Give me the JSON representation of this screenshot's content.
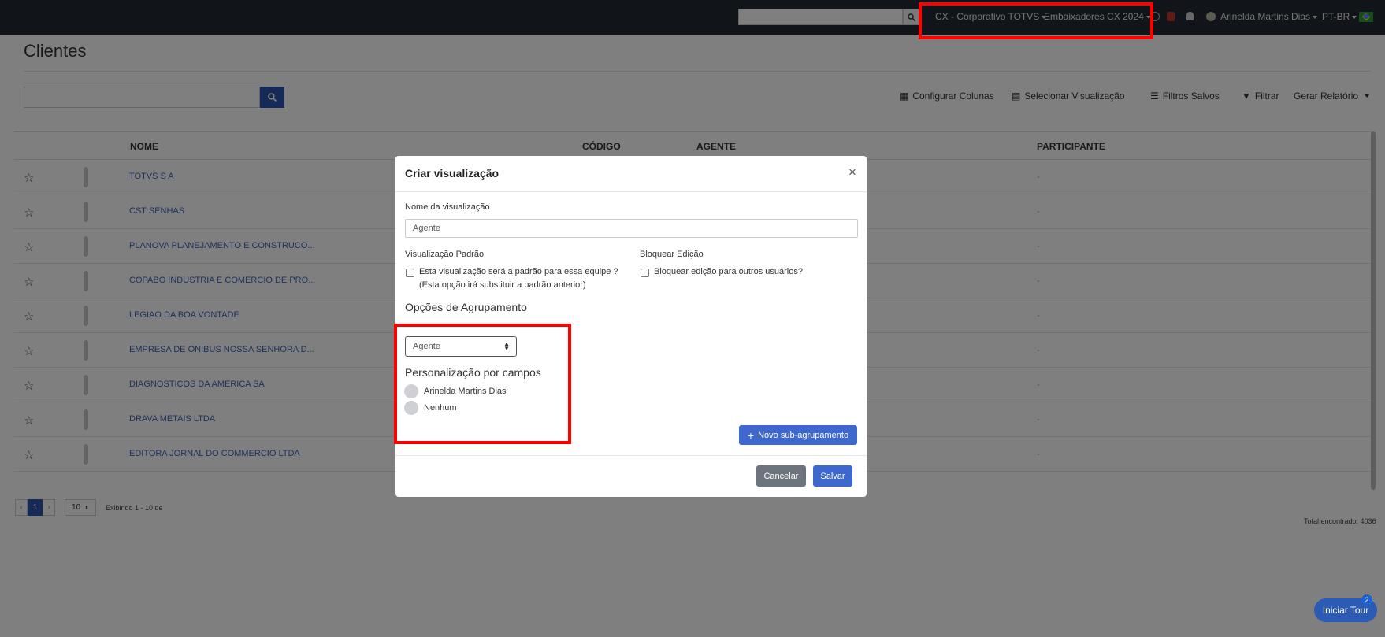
{
  "navbar": {
    "org": "CX - Corporativo TOTVS",
    "team": "Embaixadores CX 2024",
    "user": "Arinelda Martins Dias",
    "lang": "PT-BR"
  },
  "page": {
    "title": "Clientes",
    "toolbar": {
      "configurar": "Configurar Colunas",
      "selecionar": "Selecionar Visualização",
      "filtros_salvos": "Filtros Salvos",
      "filtrar": "Filtrar",
      "gerar": "Gerar Relatório"
    },
    "columns": {
      "nome": "NOME",
      "codigo": "CÓDIGO",
      "agente": "AGENTE",
      "participante": "PARTICIPANTE"
    },
    "rows": [
      {
        "name": "TOTVS S A",
        "participante": "-"
      },
      {
        "name": "CST SENHAS",
        "participante": "-"
      },
      {
        "name": "PLANOVA PLANEJAMENTO E CONSTRUCO...",
        "participante": "-"
      },
      {
        "name": "COPABO INDUSTRIA E COMERCIO DE PRO...",
        "participante": "-"
      },
      {
        "name": "LEGIAO DA BOA VONTADE",
        "participante": "-"
      },
      {
        "name": "EMPRESA DE ONIBUS NOSSA SENHORA D...",
        "participante": "-"
      },
      {
        "name": "DIAGNOSTICOS DA AMERICA SA",
        "participante": "-"
      },
      {
        "name": "DRAVA METAIS LTDA",
        "participante": "-"
      },
      {
        "name": "EDITORA JORNAL DO COMMERCIO LTDA",
        "participante": "-"
      }
    ],
    "pagination": {
      "prev": "‹",
      "current": "1",
      "next": "›",
      "per_page": "10",
      "showing": "Exibindo 1 - 10 de"
    },
    "total": "Total encontrado: 4036"
  },
  "tour": {
    "label": "Iniciar Tour",
    "badge": "2"
  },
  "modal": {
    "title": "Criar visualização",
    "name_label": "Nome da visualização",
    "name_value": "Agente",
    "default_label": "Visualização Padrão",
    "default_check_line1": "Esta visualização será a padrão para essa equipe ?",
    "default_check_line2": "(Esta opção irá substituir a padrão anterior)",
    "lock_label": "Bloquear Edição",
    "lock_check": "Bloquear edição para outros usuários?",
    "group_heading": "Opções de Agrupamento",
    "group_select_value": "Agente",
    "custom_heading": "Personalização por campos",
    "fields": [
      "Arinelda Martins Dias",
      "Nenhum"
    ],
    "new_sub": "Novo sub-agrupamento",
    "cancel": "Cancelar",
    "save": "Salvar"
  },
  "colors": {
    "navbar": "#222a33",
    "primary": "#3f68cf",
    "link": "#3f65b8",
    "highlight": "#ff0000"
  }
}
